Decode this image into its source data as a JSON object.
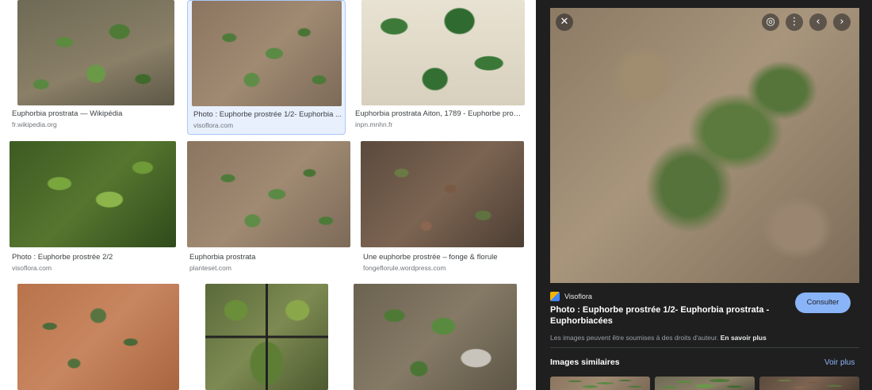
{
  "results": [
    {
      "caption": "Euphorbia prostrata — Wikipédia",
      "source": "fr.wikipedia.org"
    },
    {
      "caption": "Photo : Euphorbe prostrée 1/2- Euphorbia ...",
      "source": "visoflora.com"
    },
    {
      "caption": "Euphorbia prostrata Aiton, 1789 - Euphorbe prostr...",
      "source": "inpn.mnhn.fr"
    },
    {
      "caption": "Photo : Euphorbe prostrée 2/2",
      "source": "visoflora.com"
    },
    {
      "caption": "Euphorbia prostrata",
      "source": "planteset.com"
    },
    {
      "caption": "Une euphorbe prostrée – fonge & florule",
      "source": "fongeflorule.wordpress.com"
    },
    {
      "caption": "",
      "source": ""
    },
    {
      "caption": "",
      "source": ""
    },
    {
      "caption": "",
      "source": ""
    }
  ],
  "selected_index": 1,
  "preview": {
    "site_name": "Visoflora",
    "title": "Photo : Euphorbe prostrée 1/2- Euphorbia prostrata - Euphorbiacées",
    "visit_label": "Consulter",
    "rights_text": "Les images peuvent être soumises à des droits d'auteur.",
    "rights_link": "En savoir plus",
    "similar_heading": "Images similaires",
    "see_more_label": "Voir plus",
    "icons": [
      "close-icon",
      "lens-icon",
      "more-options-icon",
      "previous-icon",
      "next-icon"
    ]
  },
  "colors": {
    "panel_bg": "#1f1f1f",
    "accent": "#8ab4f8",
    "selected_bg": "#e8f0fe"
  }
}
